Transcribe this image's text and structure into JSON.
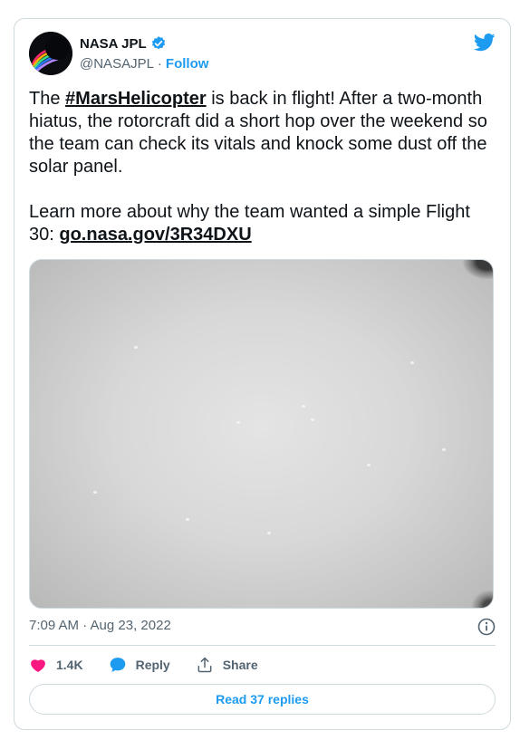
{
  "author": {
    "name": "NASA JPL",
    "handle": "@NASAJPL",
    "separator": "·",
    "follow_label": "Follow",
    "verified": true
  },
  "tweet": {
    "paragraph1_pre": "The ",
    "hashtag": "#MarsHelicopter",
    "paragraph1_post": " is back in flight! After a two-month hiatus, the rotorcraft did a short hop over the weekend so the team can check its vitals and knock some dust off the solar panel.",
    "paragraph2_pre": "Learn more about why the team wanted a simple Flight 30: ",
    "link": "go.nasa.gov/3R34DXU"
  },
  "meta": {
    "timestamp": "7:09 AM · Aug 23, 2022"
  },
  "actions": {
    "likes": "1.4K",
    "reply_label": "Reply",
    "share_label": "Share"
  },
  "footer": {
    "read_replies_label": "Read 37 replies"
  },
  "icons": {
    "brand": "twitter-bird-icon",
    "verified": "verified-badge-icon",
    "info": "info-icon",
    "like": "heart-icon",
    "reply": "speech-bubble-icon",
    "share": "share-icon"
  },
  "colors": {
    "accent": "#1d9bf0",
    "like": "#f91880",
    "text": "#0f1419",
    "muted": "#536471",
    "border": "#cfd9de"
  }
}
